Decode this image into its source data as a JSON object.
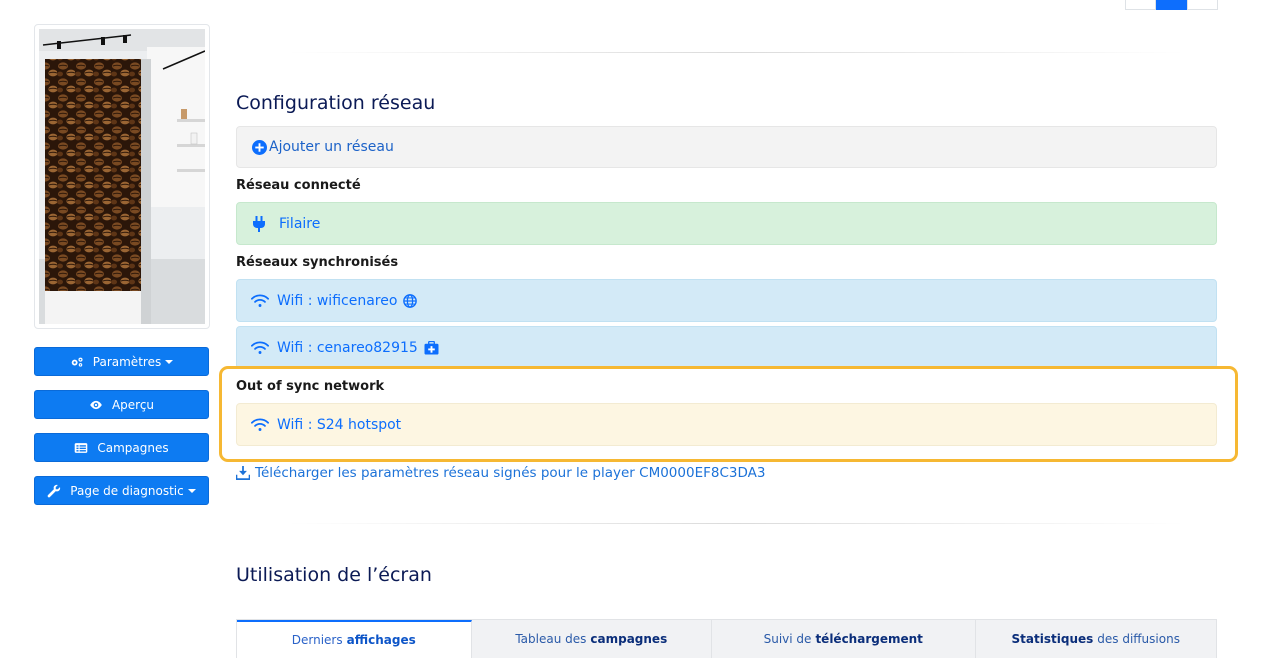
{
  "sidebar": {
    "buttons": [
      {
        "label": "Paramètres",
        "icon": "gears-icon",
        "dropdown": true
      },
      {
        "label": "Aperçu",
        "icon": "eye-icon",
        "dropdown": false
      },
      {
        "label": "Campagnes",
        "icon": "list-icon",
        "dropdown": false
      },
      {
        "label": "Page de diagnostic",
        "icon": "wrench-icon",
        "dropdown": true
      }
    ]
  },
  "network": {
    "title": "Configuration réseau",
    "add_network": "Ajouter un réseau",
    "connected_label": "Réseau connecté",
    "connected": {
      "name": "Filaire",
      "icon": "plug-icon"
    },
    "synced_label": "Réseaux synchronisés",
    "synced": [
      {
        "name": "Wifi : wificenareo",
        "badge_icon": "globe-icon"
      },
      {
        "name": "Wifi : cenareo82915",
        "badge_icon": "medkit-icon"
      }
    ],
    "out_of_sync_label": "Out of sync network",
    "out_of_sync": [
      {
        "name": "Wifi : S24 hotspot"
      }
    ],
    "download_link": "Télécharger les paramètres réseau signés pour le player CM0000EF8C3DA3"
  },
  "usage": {
    "title": "Utilisation de l’écran",
    "tabs": [
      {
        "pre": "Derniers",
        "bold": "affichages",
        "post": "",
        "active": true
      },
      {
        "pre": "Tableau des",
        "bold": "campagnes",
        "post": "",
        "active": false
      },
      {
        "pre": "Suivi de",
        "bold": "téléchargement",
        "post": "",
        "active": false
      },
      {
        "pre": "",
        "bold": "Statistiques",
        "post": "des diffusions",
        "active": false
      }
    ]
  },
  "colors": {
    "primary": "#0d7bf2",
    "highlight": "#f6b833",
    "title": "#0b1a55"
  }
}
